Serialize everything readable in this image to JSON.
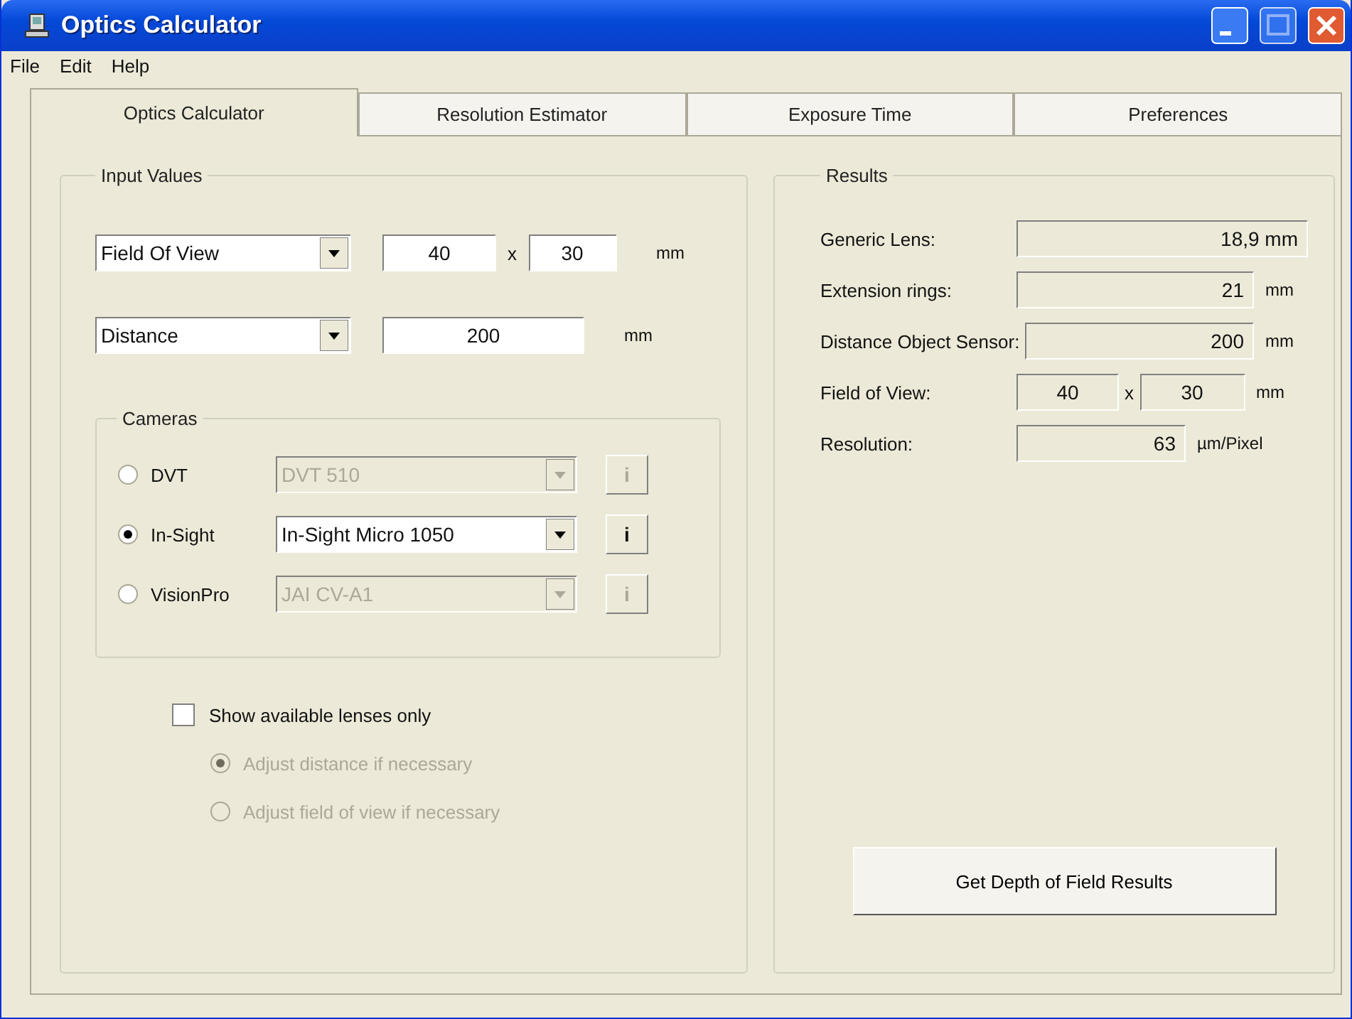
{
  "window": {
    "title": "Optics Calculator"
  },
  "menu": [
    "File",
    "Edit",
    "Help"
  ],
  "tabs": [
    {
      "label": "Optics Calculator",
      "selected": true
    },
    {
      "label": "Resolution Estimator",
      "selected": false
    },
    {
      "label": "Exposure Time",
      "selected": false
    },
    {
      "label": "Preferences",
      "selected": false
    }
  ],
  "input_values": {
    "title": "Input Values",
    "rows": [
      {
        "kind": "pair",
        "selector": "Field Of View",
        "values": [
          "40",
          "30"
        ],
        "separator": "x",
        "unit": "mm"
      },
      {
        "kind": "single",
        "selector": "Distance",
        "values": [
          "200"
        ],
        "unit": "mm"
      }
    ],
    "cameras": {
      "title": "Cameras",
      "items": [
        {
          "label": "DVT",
          "selected": false,
          "model": "DVT 510",
          "disabled": true,
          "info": "i"
        },
        {
          "label": "In-Sight",
          "selected": true,
          "model": "In-Sight Micro 1050",
          "disabled": false,
          "info": "i"
        },
        {
          "label": "VisionPro",
          "selected": false,
          "model": "JAI CV-A1",
          "disabled": true,
          "info": "i"
        }
      ]
    },
    "show_available": {
      "label": "Show available lenses only",
      "checked": false
    },
    "adjust_options": [
      {
        "label": "Adjust distance if necessary",
        "selected": true,
        "disabled": true
      },
      {
        "label": "Adjust field of view if necessary",
        "selected": false,
        "disabled": true
      }
    ]
  },
  "results": {
    "title": "Results",
    "rows": [
      {
        "kind": "single",
        "label": "Generic Lens:",
        "values": [
          "18,9 mm"
        ]
      },
      {
        "kind": "single",
        "label": "Extension rings:",
        "values": [
          "21"
        ],
        "unit": "mm"
      },
      {
        "kind": "single",
        "label": "Distance Object Sensor:",
        "values": [
          "200"
        ],
        "unit": "mm"
      },
      {
        "kind": "pair",
        "label": "Field of View:",
        "values": [
          "40",
          "30"
        ],
        "separator": "x",
        "unit": "mm"
      },
      {
        "kind": "single",
        "label": "Resolution:",
        "values": [
          "63"
        ],
        "unit": "µm/Pixel"
      }
    ],
    "button": "Get Depth of Field Results"
  }
}
